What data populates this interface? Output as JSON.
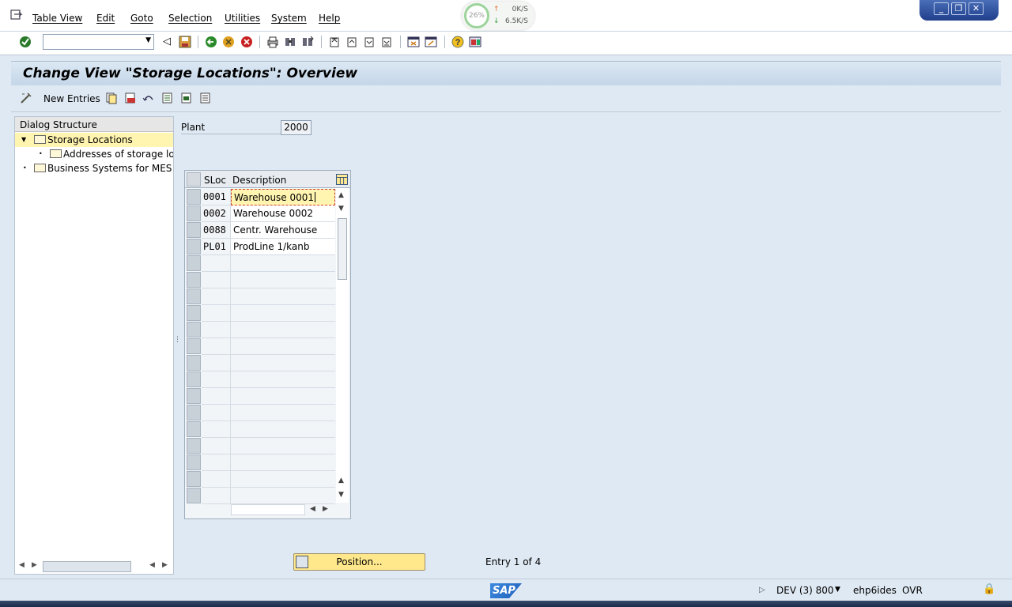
{
  "menu": {
    "items": [
      "Table View",
      "Edit",
      "Goto",
      "Selection",
      "Utilities",
      "System",
      "Help"
    ]
  },
  "net_widget": {
    "percent": "26%",
    "up": "0K/S",
    "down": "6.5K/S"
  },
  "title": "Change View \"Storage Locations\": Overview",
  "app_toolbar": {
    "new_entries": "New Entries"
  },
  "dialog_structure": {
    "header": "Dialog Structure",
    "items": [
      {
        "label": "Storage Locations",
        "level": 0,
        "expanded": true,
        "selected": true
      },
      {
        "label": "Addresses of storage loca",
        "level": 1,
        "expanded": false,
        "selected": false
      },
      {
        "label": "Business Systems for MES",
        "level": 0,
        "expanded": false,
        "selected": false
      }
    ]
  },
  "plant": {
    "label": "Plant",
    "value": "2000"
  },
  "table": {
    "columns": [
      "SLoc",
      "Description"
    ],
    "rows": [
      {
        "sloc": "0001",
        "description": "Warehouse 0001"
      },
      {
        "sloc": "0002",
        "description": "Warehouse 0002"
      },
      {
        "sloc": "0088",
        "description": "Centr. Warehouse"
      },
      {
        "sloc": "PL01",
        "description": "ProdLine 1/kanb"
      }
    ]
  },
  "position_button": "Position...",
  "entry_info": "Entry 1 of 4",
  "status": {
    "system": "DEV (3) 800",
    "server": "ehp6ides",
    "mode": "OVR"
  },
  "colors": {
    "accent_yellow": "#ffe88c",
    "selection": "#fff4b0",
    "background": "#dfe9f3"
  }
}
